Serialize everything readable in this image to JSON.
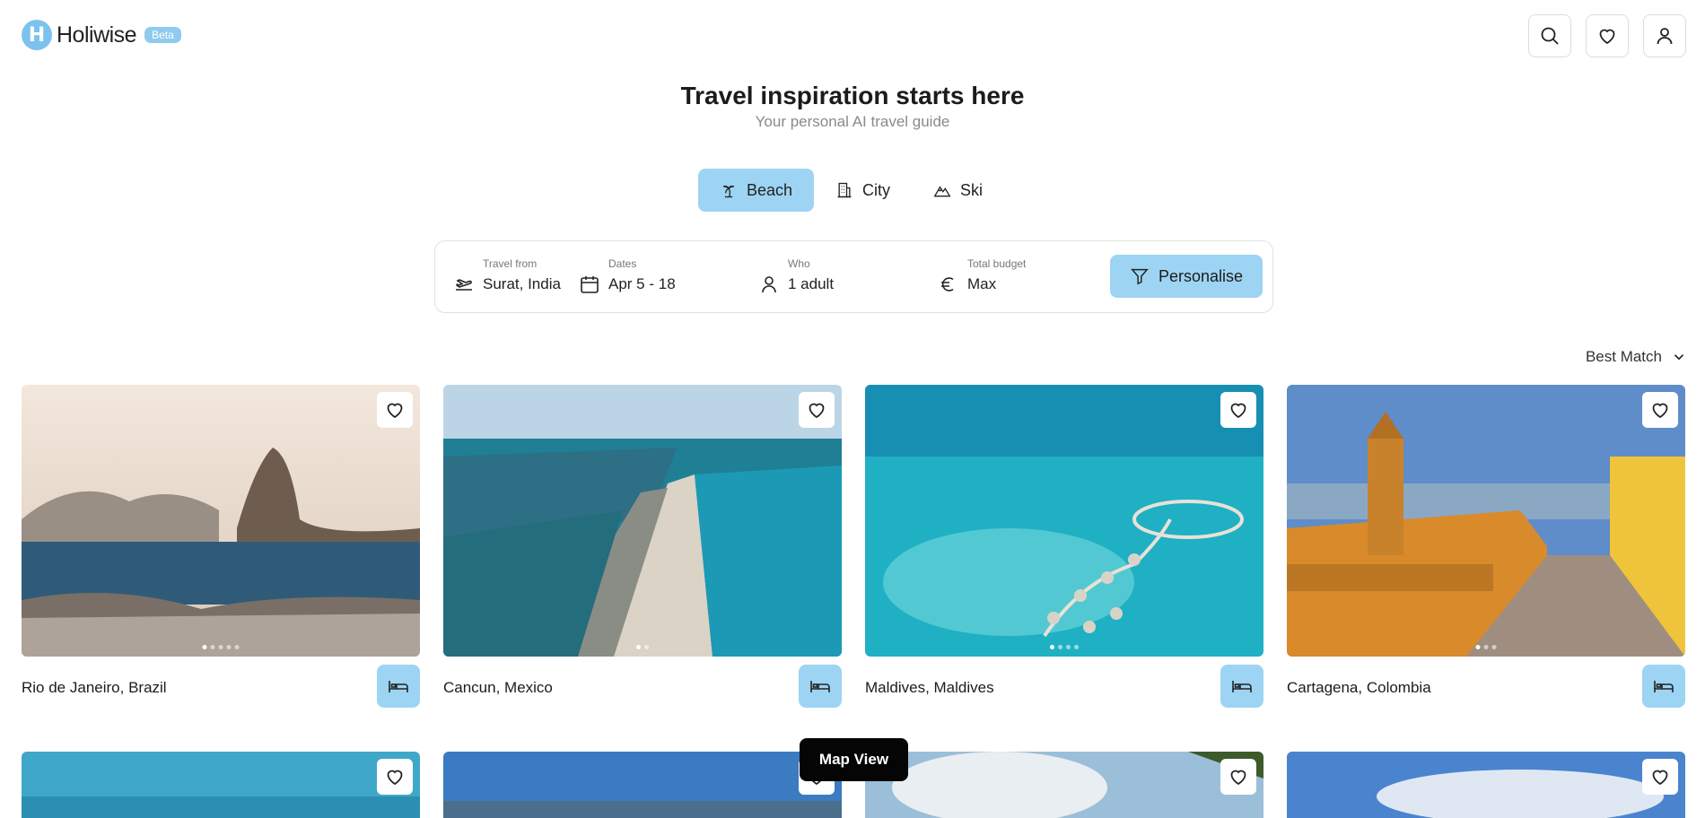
{
  "header": {
    "logo_letter": "H",
    "logo_text": "Holiwise",
    "beta_badge": "Beta",
    "icons": [
      "search-icon",
      "heart-icon",
      "user-icon"
    ]
  },
  "hero": {
    "title": "Travel inspiration starts here",
    "subtitle": "Your personal AI travel guide"
  },
  "tabs": [
    {
      "label": "Beach",
      "icon": "palm-tree-icon",
      "active": true
    },
    {
      "label": "City",
      "icon": "building-icon",
      "active": false
    },
    {
      "label": "Ski",
      "icon": "mountain-icon",
      "active": false
    }
  ],
  "search": {
    "travel_from": {
      "label": "Travel from",
      "value": "Surat, India",
      "icon": "plane-icon"
    },
    "dates": {
      "label": "Dates",
      "value": "Apr 5 - 18",
      "icon": "calendar-icon"
    },
    "who": {
      "label": "Who",
      "value": "1 adult",
      "icon": "person-icon"
    },
    "budget": {
      "label": "Total budget",
      "value": "Max",
      "icon": "euro-icon"
    },
    "personalise_label": "Personalise"
  },
  "sort": {
    "label": "Best Match"
  },
  "destinations": [
    {
      "name": "Rio de Janeiro, Brazil"
    },
    {
      "name": "Cancun, Mexico"
    },
    {
      "name": "Maldives, Maldives"
    },
    {
      "name": "Cartagena, Colombia"
    }
  ],
  "map_view_label": "Map View",
  "colors": {
    "accent": "#9dd4f3",
    "logo": "#7cc2ee",
    "text": "#1c1c1c"
  }
}
